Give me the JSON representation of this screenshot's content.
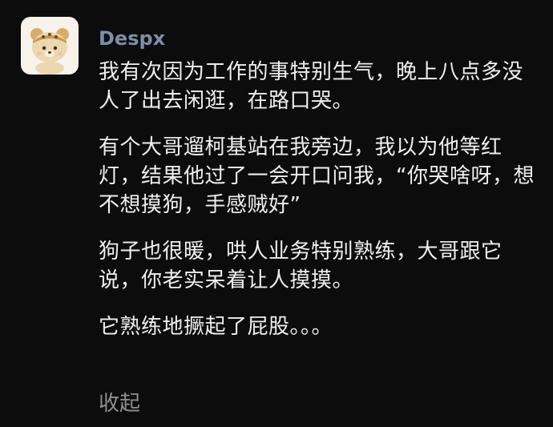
{
  "post": {
    "username": "Despx",
    "paragraphs": [
      "我有次因为工作的事特别生气，晚上八点多没人了出去闲逛，在路口哭。",
      "有个大哥遛柯基站在我旁边，我以为他等红灯，结果他过了一会开口问我，“你哭啥呀，想不想摸狗，手感贼好”",
      "狗子也很暖，哄人业务特别熟练，大哥跟它说，你老实呆着让人摸摸。",
      "它熟练地撅起了屁股。。。"
    ],
    "collapse_label": "收起"
  },
  "avatar": {
    "icon": "cartoon-bear-avatar",
    "colors": {
      "background": "#f7f2ea",
      "face": "#e9d2a8",
      "hat": "#c89a52"
    }
  },
  "colors": {
    "page_background": "#0c0c0c",
    "username": "#7a8fa8",
    "body_text": "#efefef",
    "collapse_link": "#8f8f8f"
  }
}
